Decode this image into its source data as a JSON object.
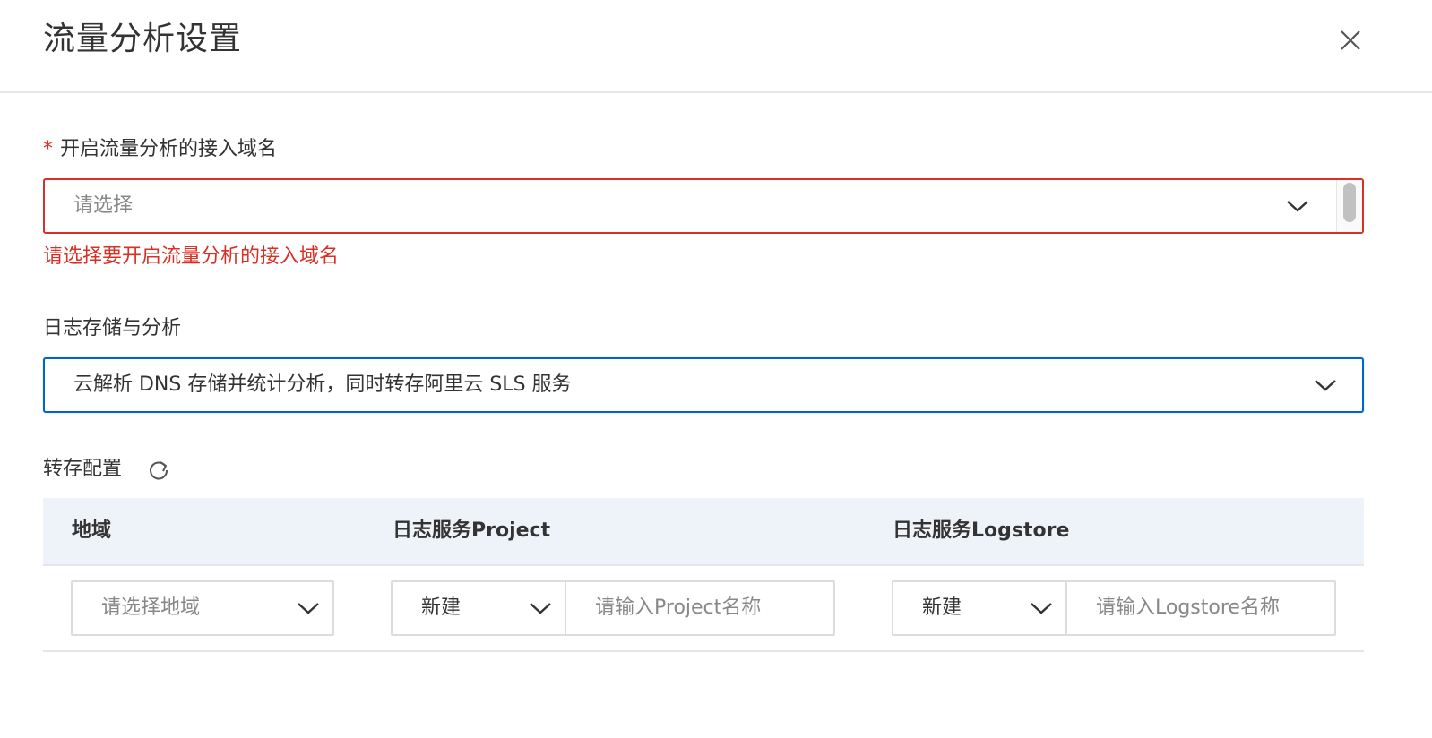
{
  "dialog": {
    "title": "流量分析设置",
    "close_icon": "close-icon"
  },
  "domain_field": {
    "required_mark": "*",
    "label": "开启流量分析的接入域名",
    "placeholder": "请选择",
    "error": "请选择要开启流量分析的接入域名",
    "status_color": "#d93026"
  },
  "storage_field": {
    "label": "日志存储与分析",
    "value": "云解析 DNS 存储并统计分析，同时转存阿里云 SLS 服务",
    "focus_color": "#0064c8"
  },
  "transfer_config": {
    "label": "转存配置",
    "refresh_icon": "refresh-icon",
    "columns": [
      "地域",
      "日志服务Project",
      "日志服务Logstore"
    ],
    "row": {
      "region_placeholder": "请选择地域",
      "project_mode": "新建",
      "project_placeholder": "请输入Project名称",
      "logstore_mode": "新建",
      "logstore_placeholder": "请输入Logstore名称"
    },
    "header_bg": "#eef2f9"
  }
}
